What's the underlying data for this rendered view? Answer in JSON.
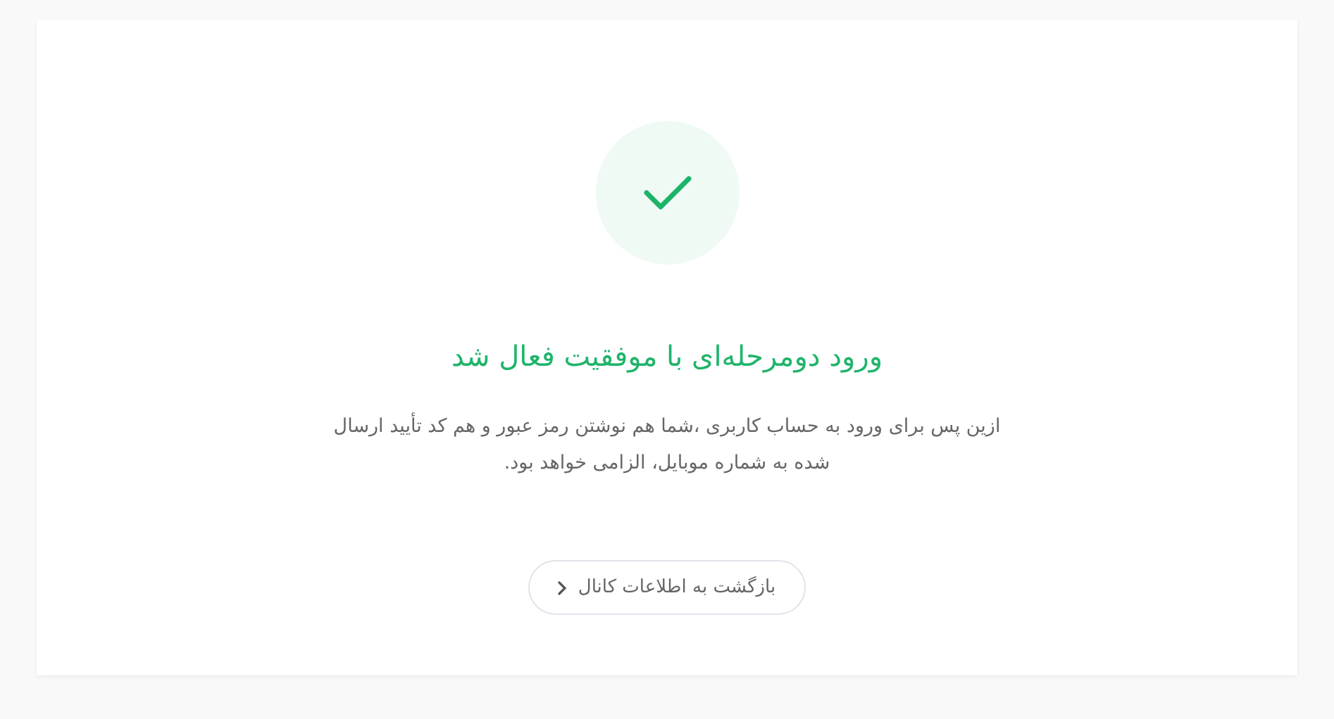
{
  "success": {
    "title": "ورود دومرحله‌ای با موفقیت فعال شد",
    "message": "ازین پس برای ورود به حساب کاربری ،شما هم نوشتن رمز عبور و هم کد تأیید ارسال شده به شماره موبایل، الزامی خواهد بود.",
    "button": "بازگشت به اطلاعات کانال"
  }
}
